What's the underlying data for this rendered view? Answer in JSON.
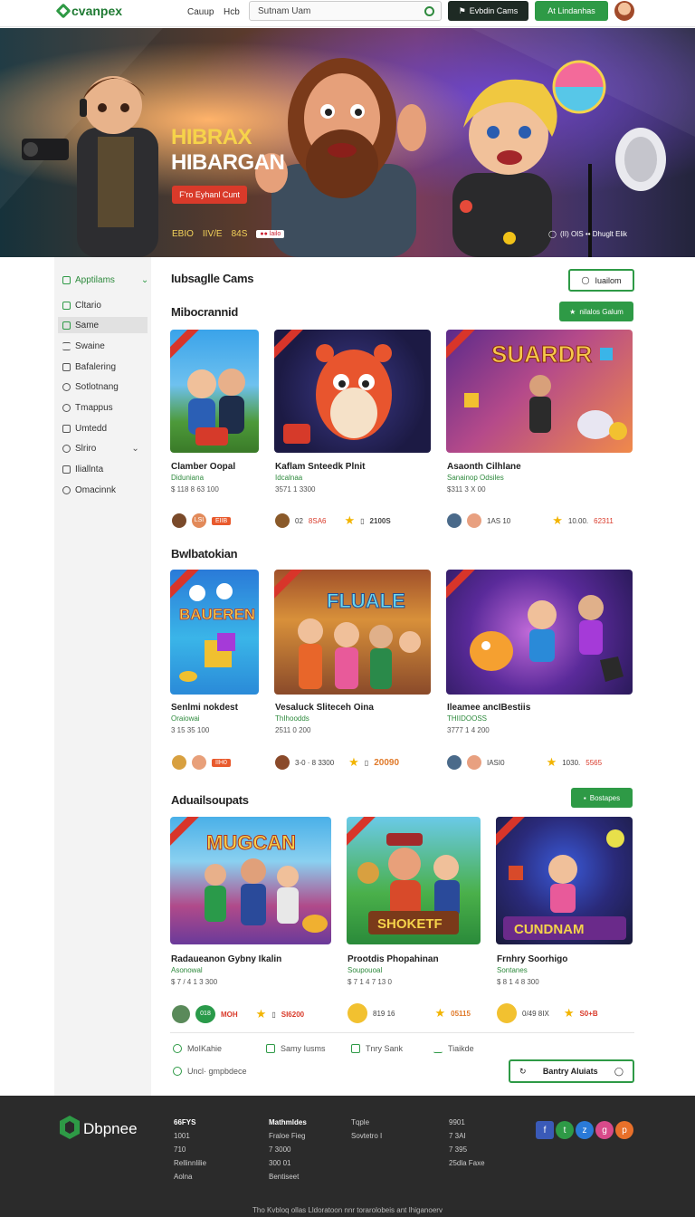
{
  "header": {
    "logo_text": "cvanpex",
    "nav": [
      "Cauup",
      "Hcb"
    ],
    "search_placeholder": "Sutnam Uam",
    "dark_button": "Evbdin Cams",
    "green_button": "At Lindanhas"
  },
  "hero": {
    "title_line1": "HIBRAX",
    "title_line2": "HIBARGAN",
    "cta": "F'ro Eyhanl Cunt",
    "stats": [
      "EBIO",
      "IIV/E",
      "84S"
    ],
    "badge": "●● lailo",
    "right_text": "(II) OIS •• Dhuglt Elik",
    "accent": "#f6d34a"
  },
  "sidebar": {
    "items": [
      {
        "label": "Apptilams",
        "icon": "checkbox-icon"
      },
      {
        "label": "Cltario",
        "icon": "grid-icon"
      },
      {
        "label": "Same",
        "icon": "square-icon"
      },
      {
        "label": "Swaine",
        "icon": "list-icon"
      },
      {
        "label": "Bafalering",
        "icon": "doc-icon"
      },
      {
        "label": "Sotlotnang",
        "icon": "play-icon"
      },
      {
        "label": "Tmappus",
        "icon": "clock-icon"
      },
      {
        "label": "Umtedd",
        "icon": "chart-icon"
      },
      {
        "label": "Slriro",
        "icon": "timer-icon"
      },
      {
        "label": "Iliallnta",
        "icon": "box-icon"
      },
      {
        "label": "Omacinnk",
        "icon": "gear-icon"
      }
    ]
  },
  "main": {
    "heading": "Iubsaglle Cams",
    "top_button": "Iuailom",
    "sections": [
      {
        "title": "Mibocrannid",
        "button": "nilalos Galum",
        "games": [
          {
            "title": "Clamber Oopal",
            "sub": "Diduniana",
            "meta": "$ 118 8 63 100",
            "footer": [
              "●",
              "LSI",
              "EIIB"
            ]
          },
          {
            "title": "Kaflam Snteedk Plnit",
            "sub": "Idcalnaa",
            "meta": "3571 1 3300",
            "footer": [
              "02",
              "8SA6",
              "★",
              "2100S"
            ]
          },
          {
            "title": "Asaonth Cilhlane",
            "sub": "Sanainop Odsiles",
            "meta": "$311 3 X 00",
            "footer": [
              "1AS 10",
              "★",
              "10.00.",
              "62311"
            ]
          }
        ]
      },
      {
        "title": "Bwlbatokian",
        "button": "",
        "games": [
          {
            "title": "Senlmi nokdest",
            "sub": "Oraiowai",
            "meta": "3 15 35 100",
            "footer": [
              "●",
              "●",
              "IIH0"
            ]
          },
          {
            "title": "Vesaluck Sliteceh Oina",
            "sub": "ThIhoodds",
            "meta": "2511 0 200",
            "footer": [
              "3-0 · 8 3300",
              "★",
              "20090"
            ]
          },
          {
            "title": "Ileamee ancIBestiis",
            "sub": "THIIDOOSS",
            "meta": "3777 1 4 200",
            "footer": [
              "IASI0",
              "★",
              "1030.",
              "5565"
            ]
          }
        ]
      },
      {
        "title": "Aduailsoupats",
        "button": "Bostapes",
        "games": [
          {
            "title": "Radaueanon Gybny Ikalin",
            "sub": "Asonowal",
            "meta": "$ 7 / 4 1 3 300",
            "footer": [
              "018",
              "MOH",
              "★",
              "SI6200"
            ]
          },
          {
            "title": "Prootdis Phopahinan",
            "sub": "Soupouoal",
            "meta": "$ 7 1 4 7 13 0",
            "footer": [
              "819 16",
              "★",
              "05115"
            ]
          },
          {
            "title": "Frnhry Soorhigo",
            "sub": "Sontanes",
            "meta": "$ 8 1 4 8 300",
            "footer": [
              "●",
              "★",
              "S0+B"
            ]
          }
        ]
      }
    ],
    "bottom_links": [
      "MoIKahie",
      "Samy Iusms",
      "Tnry Sank",
      "Tiaikde",
      "Uncl· gmpbdece"
    ],
    "bottom_button": "Bantry Aluiats"
  },
  "footer": {
    "brand": "Dbpnee",
    "cols": [
      {
        "head": "66FYS",
        "items": [
          "1001",
          "710",
          "Rellinnlilie",
          "Aolna"
        ]
      },
      {
        "head": "Mathmldes",
        "items": [
          "Fraloe Fieg",
          "7 3000",
          "300 01",
          "Bentiseet"
        ]
      },
      {
        "head": "Tqple",
        "items": [
          "Sovtetro I"
        ]
      },
      {
        "head": "9901",
        "items": [
          "7 3AI",
          "7 395",
          "25dla Faxe"
        ]
      }
    ],
    "social": [
      "f",
      "t",
      "z",
      "g",
      "p"
    ],
    "copyright": "Tho Kvbloq ollas Lldoratoon nnr torarolobeis ant Ihiganoerv"
  }
}
